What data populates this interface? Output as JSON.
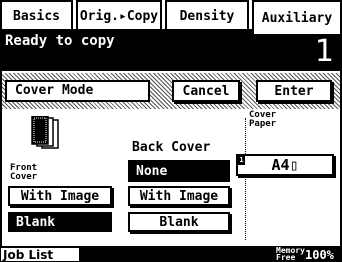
{
  "tabs": [
    {
      "label": "Basics",
      "active": false
    },
    {
      "label": "Orig.▸Copy",
      "active": false
    },
    {
      "label": "Density",
      "active": false
    },
    {
      "label": "Auxiliary",
      "active": true
    }
  ],
  "status": {
    "message": "Ready to copy",
    "copy_count": "1"
  },
  "cover_mode": {
    "title": "Cover Mode",
    "cancel_label": "Cancel",
    "enter_label": "Enter",
    "front_cover": {
      "label": "Front\nCover",
      "options": [
        {
          "label": "With Image",
          "selected": false
        },
        {
          "label": "Blank",
          "selected": true
        }
      ]
    },
    "back_cover": {
      "label": "Back Cover",
      "options": [
        {
          "label": "None",
          "selected": true
        },
        {
          "label": "With Image",
          "selected": false
        },
        {
          "label": "Blank",
          "selected": false
        }
      ]
    },
    "cover_paper": {
      "label": "Cover\nPaper",
      "tray_marker": "1",
      "value": "A4▯"
    }
  },
  "footer": {
    "job_list_label": "Job List",
    "memory_label": "Memory\nFree",
    "memory_value": "100%"
  },
  "icons": {
    "document-stack": "document-stack-icon"
  }
}
